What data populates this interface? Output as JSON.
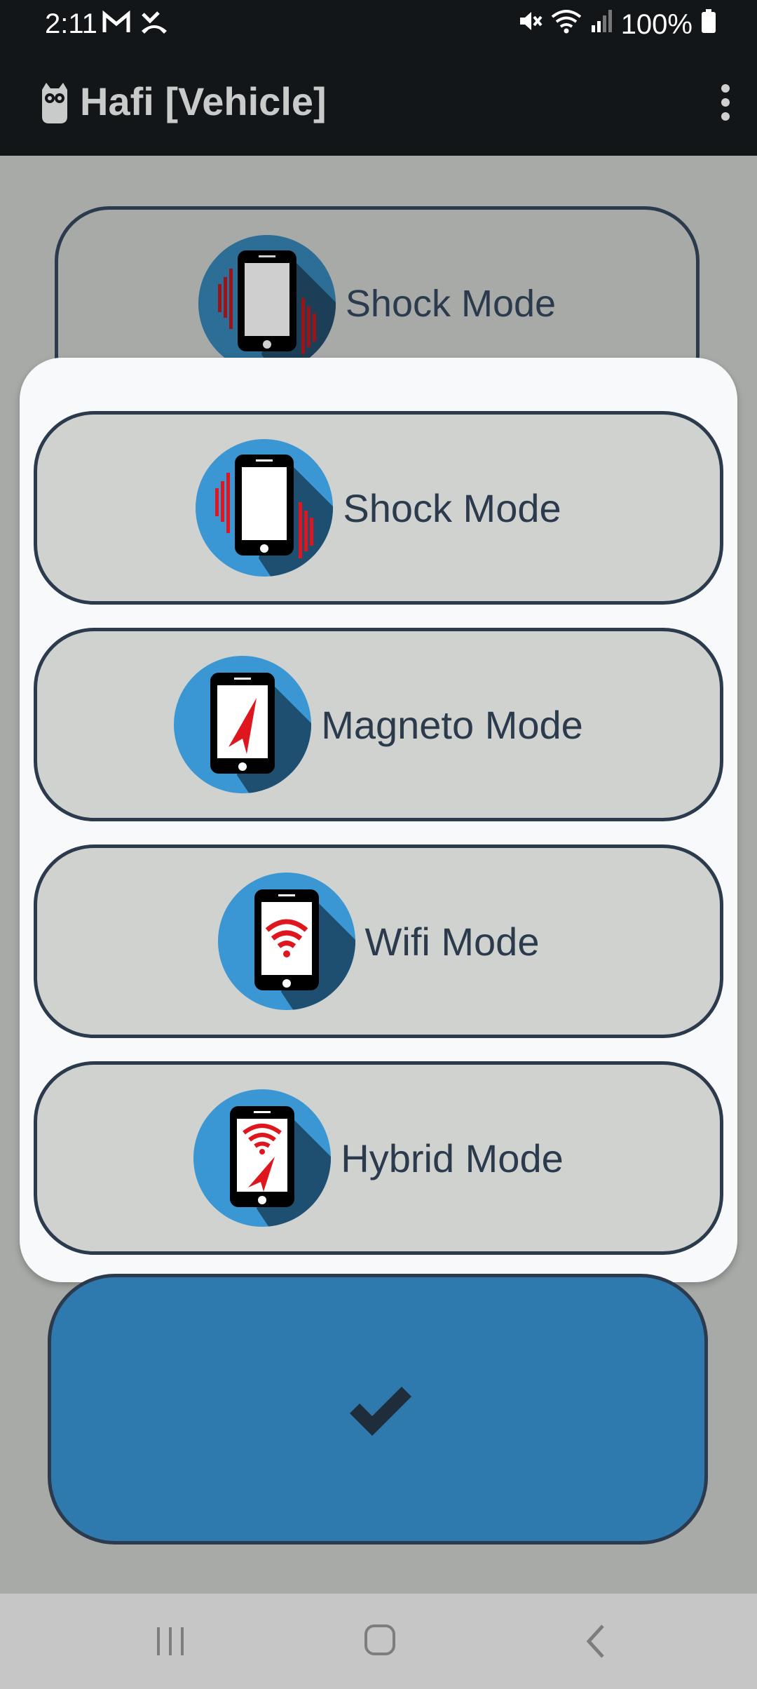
{
  "status_bar": {
    "time": "2:11",
    "battery": "100%",
    "icons": [
      "gmail-icon",
      "missed-call-icon",
      "mute-icon",
      "wifi-icon",
      "signal-icon",
      "battery-icon"
    ]
  },
  "app_bar": {
    "title": "Hafi [Vehicle]",
    "logo_icon": "owl-icon",
    "menu_icon": "overflow-menu-icon"
  },
  "background_selector": {
    "label": "Shock Mode",
    "icon": "shock-mode-icon"
  },
  "mode_options": [
    {
      "label": "Shock Mode",
      "icon": "shock-mode-icon"
    },
    {
      "label": "Magneto Mode",
      "icon": "magneto-mode-icon"
    },
    {
      "label": "Wifi Mode",
      "icon": "wifi-mode-icon"
    },
    {
      "label": "Hybrid Mode",
      "icon": "hybrid-mode-icon"
    }
  ],
  "confirm_button": {
    "icon": "check-icon"
  },
  "nav_bar": {
    "icons": [
      "recents-icon",
      "home-icon",
      "back-icon"
    ]
  },
  "colors": {
    "dark_bar": "#121619",
    "scrim": "#a8aaa8",
    "option_fill": "#d0d2cf",
    "option_border": "#2b3a4c",
    "confirm_fill": "#2e7aae",
    "icon_blue": "#3b97d3",
    "icon_shadow": "#1e4f70",
    "accent_red": "#e0161e"
  }
}
